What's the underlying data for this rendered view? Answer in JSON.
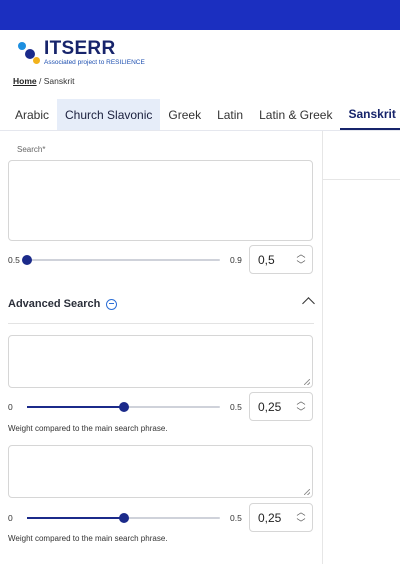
{
  "brand": {
    "title": "ITSERR",
    "subtitle": "Associated project to RESILIENCE"
  },
  "breadcrumb": {
    "home": "Home",
    "separator": "/",
    "current": "Sanskrit"
  },
  "tabs": [
    {
      "label": "Arabic"
    },
    {
      "label": "Church Slavonic"
    },
    {
      "label": "Greek"
    },
    {
      "label": "Latin"
    },
    {
      "label": "Latin & Greek"
    },
    {
      "label": "Sanskrit"
    }
  ],
  "active_tab": "Sanskrit",
  "search": {
    "label": "Search*",
    "value": "",
    "slider_min": "0.5",
    "slider_max": "0.9",
    "slider_value": 0.5,
    "stepper_value": "0,5"
  },
  "advanced": {
    "title": "Advanced Search",
    "fields": [
      {
        "value": "",
        "slider_min": "0",
        "slider_max": "0.5",
        "slider_value": 0.25,
        "stepper_value": "0,25",
        "hint": "Weight compared to the main search phrase."
      },
      {
        "value": "",
        "slider_min": "0",
        "slider_max": "0.5",
        "slider_value": 0.25,
        "stepper_value": "0,25",
        "hint": "Weight compared to the main search phrase."
      }
    ]
  },
  "colors": {
    "topbar": "#1b2fc0",
    "accent": "#1b2a8a",
    "tab_highlight": "#e6edf9"
  }
}
